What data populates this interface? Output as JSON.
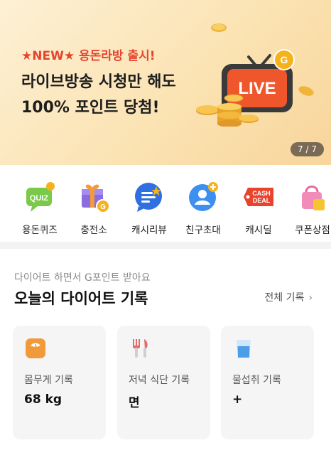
{
  "banner": {
    "subtitle": "★NEW★ 용돈라방 출시!",
    "title_line1": "라이브방송 시청만 해도",
    "title_line2": "100% 포인트 당첨!",
    "tv_label": "LIVE",
    "coin_label": "G",
    "counter": "7 / 7"
  },
  "menu": [
    {
      "label": "용돈퀴즈",
      "icon": "quiz-icon",
      "badge": "QUIZ"
    },
    {
      "label": "충전소",
      "icon": "gift-icon"
    },
    {
      "label": "캐시리뷰",
      "icon": "review-chat-icon"
    },
    {
      "label": "친구초대",
      "icon": "invite-friend-icon"
    },
    {
      "label": "캐시딜",
      "icon": "cash-deal-icon",
      "badge": "CASH DEAL"
    },
    {
      "label": "쿠폰상점",
      "icon": "coupon-shop-icon"
    }
  ],
  "diet": {
    "caption": "다이어트 하면서 G포인트 받아요",
    "heading": "오늘의 다이어트 기록",
    "view_all": "전체 기록",
    "tiles": [
      {
        "label": "몸무게 기록",
        "value": "68 kg",
        "icon": "scale-icon"
      },
      {
        "label": "저녁 식단 기록",
        "value": "면",
        "icon": "fork-knife-icon"
      },
      {
        "label": "물섭취 기록",
        "value": "+",
        "icon": "water-cup-icon"
      }
    ]
  },
  "colors": {
    "accent_red": "#e8432d",
    "coin_gold": "#f5b21d",
    "banner_bg": "#fbe3b3"
  }
}
